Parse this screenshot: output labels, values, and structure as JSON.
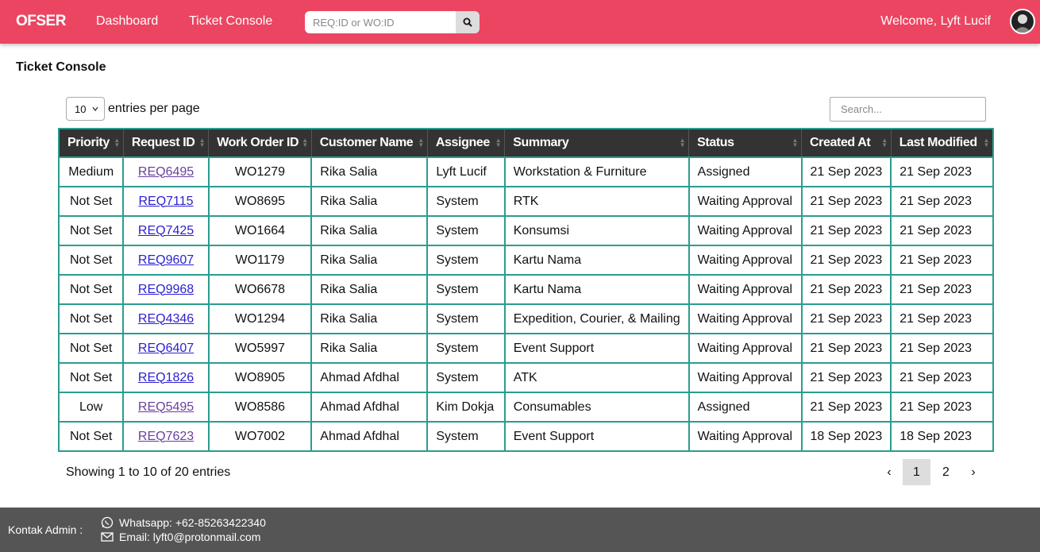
{
  "navbar": {
    "brand": "OFSER",
    "links": [
      "Dashboard",
      "Ticket Console"
    ],
    "search_placeholder": "REQ:ID or WO:ID",
    "welcome": "Welcome, Lyft Lucif",
    "accent_color": "#ec4561"
  },
  "page": {
    "title": "Ticket Console"
  },
  "controls": {
    "entries_value": "10",
    "entries_label": "entries per page",
    "search_placeholder": "Search..."
  },
  "table": {
    "columns": [
      "Priority",
      "Request ID",
      "Work Order ID",
      "Customer Name",
      "Assignee",
      "Summary",
      "Status",
      "Created At",
      "Last Modified"
    ],
    "rows": [
      [
        "Medium",
        "REQ6495",
        "WO1279",
        "Rika Salia",
        "Lyft Lucif",
        "Workstation & Furniture",
        "Assigned",
        "21 Sep 2023",
        "21 Sep 2023"
      ],
      [
        "Not Set",
        "REQ7115",
        "WO8695",
        "Rika Salia",
        "System",
        "RTK",
        "Waiting Approval",
        "21 Sep 2023",
        "21 Sep 2023"
      ],
      [
        "Not Set",
        "REQ7425",
        "WO1664",
        "Rika Salia",
        "System",
        "Konsumsi",
        "Waiting Approval",
        "21 Sep 2023",
        "21 Sep 2023"
      ],
      [
        "Not Set",
        "REQ9607",
        "WO1179",
        "Rika Salia",
        "System",
        "Kartu Nama",
        "Waiting Approval",
        "21 Sep 2023",
        "21 Sep 2023"
      ],
      [
        "Not Set",
        "REQ9968",
        "WO6678",
        "Rika Salia",
        "System",
        "Kartu Nama",
        "Waiting Approval",
        "21 Sep 2023",
        "21 Sep 2023"
      ],
      [
        "Not Set",
        "REQ4346",
        "WO1294",
        "Rika Salia",
        "System",
        "Expedition, Courier, & Mailing",
        "Waiting Approval",
        "21 Sep 2023",
        "21 Sep 2023"
      ],
      [
        "Not Set",
        "REQ6407",
        "WO5997",
        "Rika Salia",
        "System",
        "Event Support",
        "Waiting Approval",
        "21 Sep 2023",
        "21 Sep 2023"
      ],
      [
        "Not Set",
        "REQ1826",
        "WO8905",
        "Ahmad Afdhal",
        "System",
        "ATK",
        "Waiting Approval",
        "21 Sep 2023",
        "21 Sep 2023"
      ],
      [
        "Low",
        "REQ5495",
        "WO8586",
        "Ahmad Afdhal",
        "Kim Dokja",
        "Consumables",
        "Assigned",
        "21 Sep 2023",
        "21 Sep 2023"
      ],
      [
        "Not Set",
        "REQ7623",
        "WO7002",
        "Ahmad Afdhal",
        "System",
        "Event Support",
        "Waiting Approval",
        "18 Sep 2023",
        "18 Sep 2023"
      ]
    ],
    "visited_links": [
      "REQ6495",
      "REQ5495",
      "REQ7623"
    ]
  },
  "footer_info": {
    "showing": "Showing 1 to 10 of 20 entries",
    "pagination": {
      "prev": "‹",
      "pages": [
        "1",
        "2"
      ],
      "current": "1",
      "next": "›"
    }
  },
  "footer": {
    "kontak": "Kontak Admin :",
    "whatsapp": "Whatsapp: +62-85263422340",
    "email": "Email: lyft0@protonmail.com"
  }
}
